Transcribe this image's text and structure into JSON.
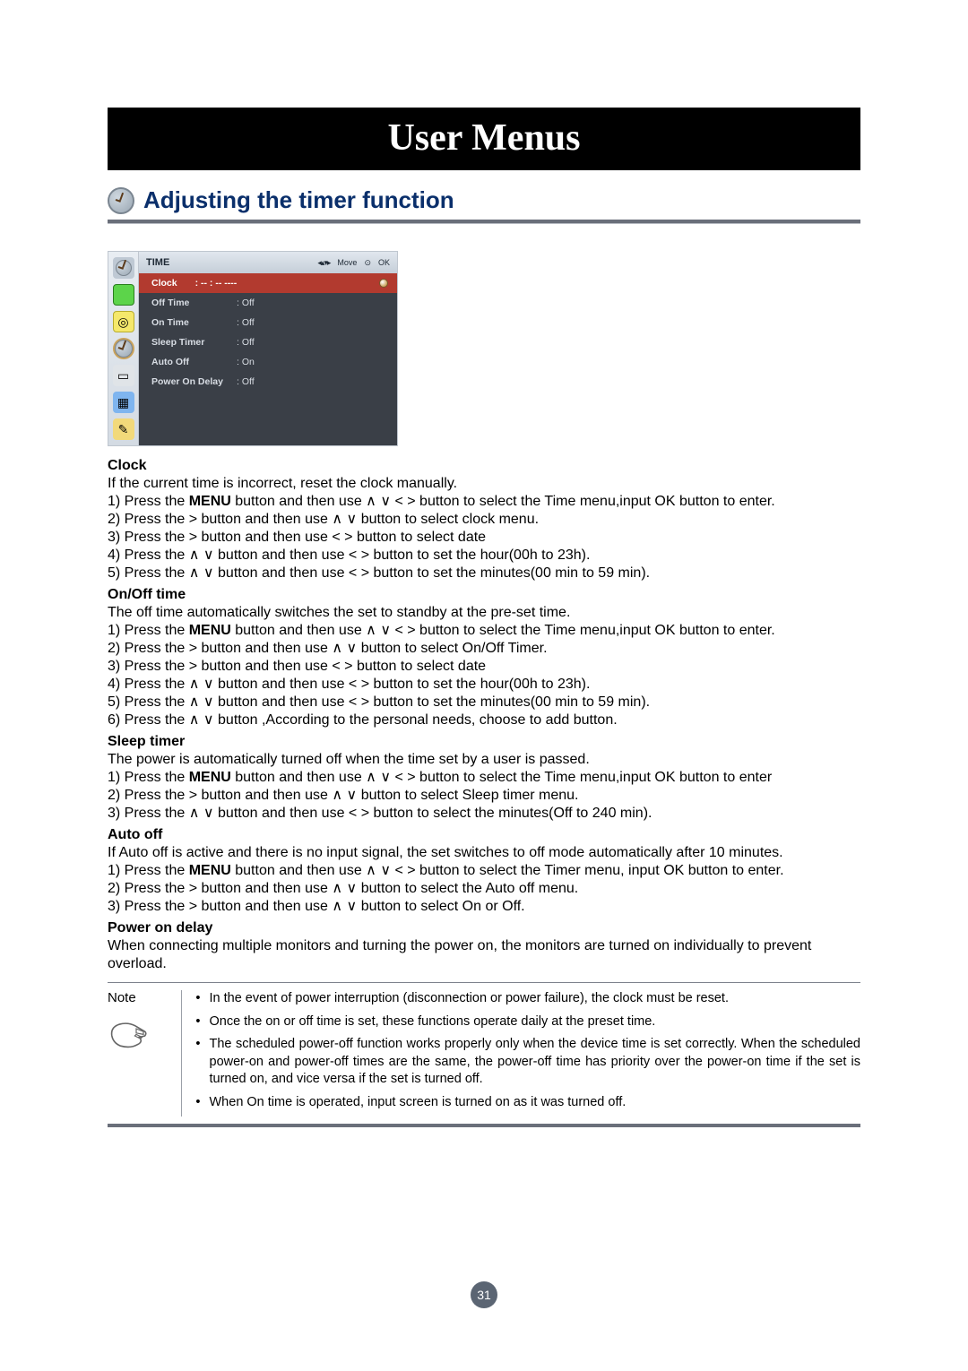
{
  "page": {
    "title": "User Menus",
    "section_heading": "Adjusting the timer function",
    "page_number": "31"
  },
  "osd": {
    "title": "TIME",
    "nav_move": "Move",
    "nav_ok": "OK",
    "selected": {
      "label": "Clock",
      "value": ": -- : -- ----"
    },
    "rows": [
      {
        "label": "Off Time",
        "value": ": Off"
      },
      {
        "label": "On Time",
        "value": ": Off"
      },
      {
        "label": "Sleep Timer",
        "value": ": Off"
      },
      {
        "label": "Auto Off",
        "value": ": On"
      },
      {
        "label": "Power On Delay",
        "value": ": Off"
      }
    ]
  },
  "sections": {
    "clock": {
      "heading": "Clock",
      "intro": "If the current time is incorrect, reset the clock manually.",
      "menu_word": "MENU",
      "l1a": "1) Press the ",
      "l1b": " button and then use ∧ ∨ < > button to select the Time menu,input OK button to enter.",
      "l2": "2) Press the > button and then use ∧ ∨ button to select clock menu.",
      "l3": "3) Press the > button and then use < > button to select date",
      "l4": "4) Press the ∧ ∨ button and then use < > button to set the hour(00h to 23h).",
      "l5": "5) Press the ∧ ∨ button and then use < > button to set the minutes(00 min to 59 min)."
    },
    "onoff": {
      "heading": "On/Off time",
      "intro": "The off time automatically switches the set to standby at the pre-set time.",
      "l1a": "1) Press the ",
      "l1b": " button and then use ∧ ∨ < > button to select the Time menu,input OK button to enter.",
      "l2": "2) Press the > button and then use ∧ ∨ button to select On/Off Timer.",
      "l3": "3) Press the > button and then use < > button to select date",
      "l4": "4) Press the ∧ ∨ button and then use < > button to set the hour(00h to 23h).",
      "l5": "5) Press the ∧ ∨ button and then use < > button to set the minutes(00 min to 59 min).",
      "l6": "6) Press the ∧ ∨ button ,According to the personal needs, choose to add button."
    },
    "sleep": {
      "heading": "Sleep timer",
      "intro": "The power is automatically turned off when the time set by a user is passed.",
      "l1a": "1) Press the ",
      "l1b": " button and then use ∧ ∨ < > button to select the Time menu,input OK button to enter",
      "l2": "2) Press the > button and then use ∧ ∨ button to select  Sleep timer menu.",
      "l3": "3) Press the ∧ ∨ button and then use < > button to select the minutes(Off to 240 min)."
    },
    "auto": {
      "heading": "Auto off",
      "intro": "If Auto off is active and there is no input signal, the set switches to off mode automatically after 10 minutes.",
      "l1a": "1) Press the ",
      "l1b": " button and then use ∧ ∨ < > button to select the Timer menu, input OK button to enter.",
      "l2": "2) Press the > button and then use ∧ ∨ button to select the Auto off menu.",
      "l3": "3) Press the > button and then use ∧ ∨ button to select On or Off."
    },
    "pod": {
      "heading": "Power on delay",
      "text": "When connecting multiple monitors and turning the power on, the monitors are turned on individually to prevent overload."
    }
  },
  "note": {
    "label": "Note",
    "items": [
      "In the event of power interruption (disconnection or power failure), the clock must be reset.",
      "Once the on or off time is set, these functions operate daily at the preset time.",
      "The scheduled power-off function works properly only when the device time is set correctly. When the scheduled power-on and power-off times are the same, the power-off time has priority over the power-on time if the set is turned on, and vice versa if the set is turned off.",
      "When On time is operated, input screen is turned on as it was turned off."
    ]
  }
}
